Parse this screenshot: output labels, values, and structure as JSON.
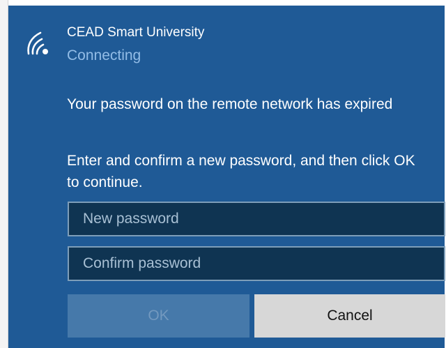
{
  "network": {
    "name": "CEAD Smart University",
    "status": "Connecting",
    "icon": "wifi-icon"
  },
  "dialog": {
    "message": "Your password on the remote network has expired",
    "instruction": "Enter and confirm a new password, and then click OK to continue."
  },
  "inputs": {
    "new_password": {
      "value": "",
      "placeholder": "New password"
    },
    "confirm_password": {
      "value": "",
      "placeholder": "Confirm password"
    }
  },
  "buttons": {
    "ok_label": "OK",
    "cancel_label": "Cancel"
  },
  "colors": {
    "panel_background": "#1f5a96",
    "input_background": "#0f3452",
    "input_border": "#7e9eb9",
    "disabled_ok_background": "#4679aa",
    "cancel_background": "#d7d7d7",
    "status_text": "#93bde7"
  }
}
